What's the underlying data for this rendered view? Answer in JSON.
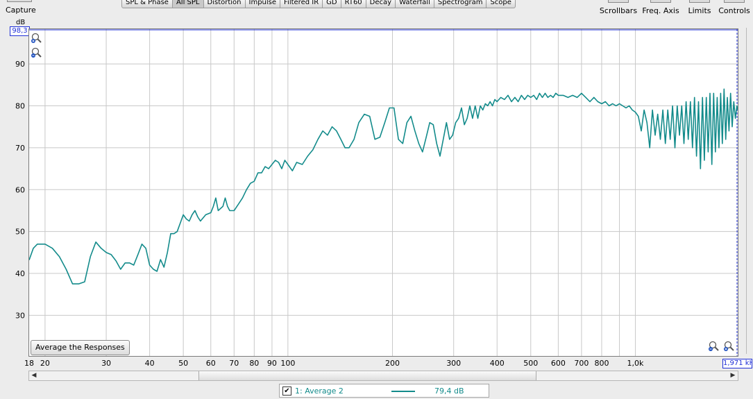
{
  "toolbar": {
    "capture_label": "Capture",
    "tabs": [
      "SPL & Phase",
      "All SPL",
      "Distortion",
      "Impulse",
      "Filtered IR",
      "GD",
      "RT60",
      "Decay",
      "Waterfall",
      "Spectrogram",
      "Scope"
    ],
    "active_tab": "All SPL",
    "right_tools": [
      "Scrollbars",
      "Freq. Axis",
      "Limits",
      "Controls"
    ]
  },
  "plot": {
    "y_unit": "dB",
    "y_max_display": "98,3",
    "x_max_display": "1,971 kHz",
    "average_button_label": "Average the Responses"
  },
  "legend": {
    "checked": true,
    "name": "1: Average 2",
    "value": "79,4 dB"
  },
  "colors": {
    "trace": "#138b8b",
    "grid": "#c8c8c8",
    "cursor": "#1e2ed6"
  },
  "icons": {
    "zoom_in": "zoom-in-icon",
    "zoom_out": "zoom-out-icon",
    "scroll_left": "arrow-left-icon",
    "scroll_right": "arrow-right-icon"
  },
  "chart_data": {
    "type": "line",
    "x_scale": "log",
    "xlim": [
      18,
      1971
    ],
    "ylim": [
      20.3,
      98.3
    ],
    "grid": true,
    "y_ticks": [
      30,
      40,
      50,
      60,
      70,
      80,
      90
    ],
    "y_tick_labels": [
      "30",
      "40",
      "50",
      "60",
      "70",
      "80",
      "90"
    ],
    "x_ticks": [
      18,
      20,
      30,
      40,
      50,
      60,
      70,
      80,
      90,
      100,
      200,
      300,
      400,
      500,
      600,
      700,
      800,
      1000
    ],
    "x_tick_labels": [
      "18",
      "20",
      "30",
      "40",
      "50",
      "60",
      "70",
      "80",
      "90",
      "100",
      "200",
      "300",
      "400",
      "500",
      "600",
      "700",
      "800",
      "1,0k"
    ],
    "series": [
      {
        "name": "1: Average 2",
        "points": [
          [
            18,
            43.2
          ],
          [
            18.5,
            46
          ],
          [
            19,
            47
          ],
          [
            20,
            47
          ],
          [
            21,
            46
          ],
          [
            22,
            44
          ],
          [
            23,
            41
          ],
          [
            24,
            37.5
          ],
          [
            25,
            37.5
          ],
          [
            26,
            38
          ],
          [
            27,
            44
          ],
          [
            28,
            47.5
          ],
          [
            29,
            46
          ],
          [
            30,
            45
          ],
          [
            31,
            44.5
          ],
          [
            32,
            43
          ],
          [
            33,
            41
          ],
          [
            34,
            42.5
          ],
          [
            35,
            42.5
          ],
          [
            36,
            42
          ],
          [
            37,
            44.5
          ],
          [
            38,
            47
          ],
          [
            39,
            46
          ],
          [
            40,
            42
          ],
          [
            41,
            41
          ],
          [
            42,
            40.5
          ],
          [
            43,
            43.3
          ],
          [
            44,
            41.5
          ],
          [
            45,
            45
          ],
          [
            46,
            49.5
          ],
          [
            47,
            49.5
          ],
          [
            48,
            50
          ],
          [
            50,
            54
          ],
          [
            51,
            53
          ],
          [
            52,
            52.5
          ],
          [
            53,
            54
          ],
          [
            54,
            55
          ],
          [
            55,
            53.5
          ],
          [
            56,
            52.5
          ],
          [
            58,
            54
          ],
          [
            60,
            54.5
          ],
          [
            61,
            56
          ],
          [
            62,
            58
          ],
          [
            63,
            55
          ],
          [
            65,
            56
          ],
          [
            66,
            58
          ],
          [
            67,
            56
          ],
          [
            68,
            55
          ],
          [
            70,
            55
          ],
          [
            72,
            56.5
          ],
          [
            74,
            58
          ],
          [
            76,
            60
          ],
          [
            78,
            61.5
          ],
          [
            80,
            62
          ],
          [
            82,
            64
          ],
          [
            84,
            64
          ],
          [
            86,
            65.5
          ],
          [
            88,
            65
          ],
          [
            90,
            66
          ],
          [
            92,
            67
          ],
          [
            94,
            66.5
          ],
          [
            96,
            65
          ],
          [
            98,
            67
          ],
          [
            100,
            66
          ],
          [
            103,
            64.5
          ],
          [
            106,
            66.5
          ],
          [
            110,
            66
          ],
          [
            114,
            68
          ],
          [
            118,
            69.5
          ],
          [
            122,
            72
          ],
          [
            126,
            74
          ],
          [
            130,
            73
          ],
          [
            134,
            75
          ],
          [
            138,
            74
          ],
          [
            142,
            72
          ],
          [
            146,
            70
          ],
          [
            150,
            70
          ],
          [
            155,
            72
          ],
          [
            160,
            76
          ],
          [
            166,
            78
          ],
          [
            172,
            77.5
          ],
          [
            178,
            72
          ],
          [
            184,
            72.5
          ],
          [
            190,
            76
          ],
          [
            196,
            79.5
          ],
          [
            202,
            79.5
          ],
          [
            208,
            72
          ],
          [
            214,
            71
          ],
          [
            220,
            76
          ],
          [
            226,
            77.5
          ],
          [
            232,
            74
          ],
          [
            238,
            71
          ],
          [
            244,
            69
          ],
          [
            250,
            72.5
          ],
          [
            256,
            76
          ],
          [
            262,
            75.5
          ],
          [
            268,
            71
          ],
          [
            274,
            68
          ],
          [
            280,
            72
          ],
          [
            286,
            76
          ],
          [
            292,
            72
          ],
          [
            298,
            73
          ],
          [
            304,
            76
          ],
          [
            310,
            77
          ],
          [
            316,
            79.5
          ],
          [
            322,
            75.5
          ],
          [
            328,
            77
          ],
          [
            334,
            80
          ],
          [
            340,
            77
          ],
          [
            346,
            80
          ],
          [
            352,
            77
          ],
          [
            358,
            80
          ],
          [
            364,
            79
          ],
          [
            370,
            80.5
          ],
          [
            376,
            80
          ],
          [
            382,
            81
          ],
          [
            388,
            80
          ],
          [
            394,
            81.5
          ],
          [
            400,
            81
          ],
          [
            410,
            82
          ],
          [
            420,
            81.5
          ],
          [
            430,
            82.5
          ],
          [
            440,
            81
          ],
          [
            450,
            82
          ],
          [
            460,
            81
          ],
          [
            470,
            82.5
          ],
          [
            480,
            81.5
          ],
          [
            490,
            82.5
          ],
          [
            500,
            82
          ],
          [
            510,
            82.5
          ],
          [
            520,
            81.5
          ],
          [
            530,
            83
          ],
          [
            540,
            82
          ],
          [
            550,
            83
          ],
          [
            560,
            82
          ],
          [
            570,
            82.5
          ],
          [
            580,
            82
          ],
          [
            590,
            83
          ],
          [
            600,
            82.5
          ],
          [
            620,
            82.5
          ],
          [
            640,
            82
          ],
          [
            660,
            82.5
          ],
          [
            680,
            82
          ],
          [
            700,
            83
          ],
          [
            720,
            82
          ],
          [
            740,
            81
          ],
          [
            760,
            82
          ],
          [
            780,
            81
          ],
          [
            800,
            80.5
          ],
          [
            820,
            81
          ],
          [
            840,
            80
          ],
          [
            860,
            80.5
          ],
          [
            880,
            80
          ],
          [
            900,
            80.5
          ],
          [
            920,
            80
          ],
          [
            940,
            79.5
          ],
          [
            960,
            80
          ],
          [
            980,
            79
          ],
          [
            1000,
            78.5
          ],
          [
            1020,
            77.5
          ],
          [
            1040,
            74
          ],
          [
            1060,
            79
          ],
          [
            1080,
            76
          ],
          [
            1100,
            70
          ],
          [
            1120,
            79
          ],
          [
            1140,
            73
          ],
          [
            1160,
            78
          ],
          [
            1180,
            72
          ],
          [
            1200,
            79
          ],
          [
            1220,
            71
          ],
          [
            1240,
            79
          ],
          [
            1260,
            72
          ],
          [
            1280,
            80
          ],
          [
            1300,
            70
          ],
          [
            1320,
            80
          ],
          [
            1340,
            73
          ],
          [
            1360,
            80
          ],
          [
            1380,
            71
          ],
          [
            1400,
            81
          ],
          [
            1420,
            72
          ],
          [
            1440,
            81
          ],
          [
            1460,
            70
          ],
          [
            1480,
            82
          ],
          [
            1500,
            68
          ],
          [
            1520,
            81
          ],
          [
            1540,
            65
          ],
          [
            1560,
            82
          ],
          [
            1580,
            67
          ],
          [
            1600,
            82
          ],
          [
            1620,
            69
          ],
          [
            1640,
            83
          ],
          [
            1660,
            66
          ],
          [
            1680,
            83
          ],
          [
            1700,
            69
          ],
          [
            1720,
            82
          ],
          [
            1740,
            70
          ],
          [
            1760,
            83
          ],
          [
            1780,
            71
          ],
          [
            1800,
            84
          ],
          [
            1820,
            72
          ],
          [
            1840,
            82
          ],
          [
            1860,
            74
          ],
          [
            1880,
            83
          ],
          [
            1900,
            75
          ],
          [
            1920,
            81
          ],
          [
            1940,
            77
          ],
          [
            1960,
            80
          ],
          [
            1971,
            79
          ]
        ]
      }
    ]
  }
}
